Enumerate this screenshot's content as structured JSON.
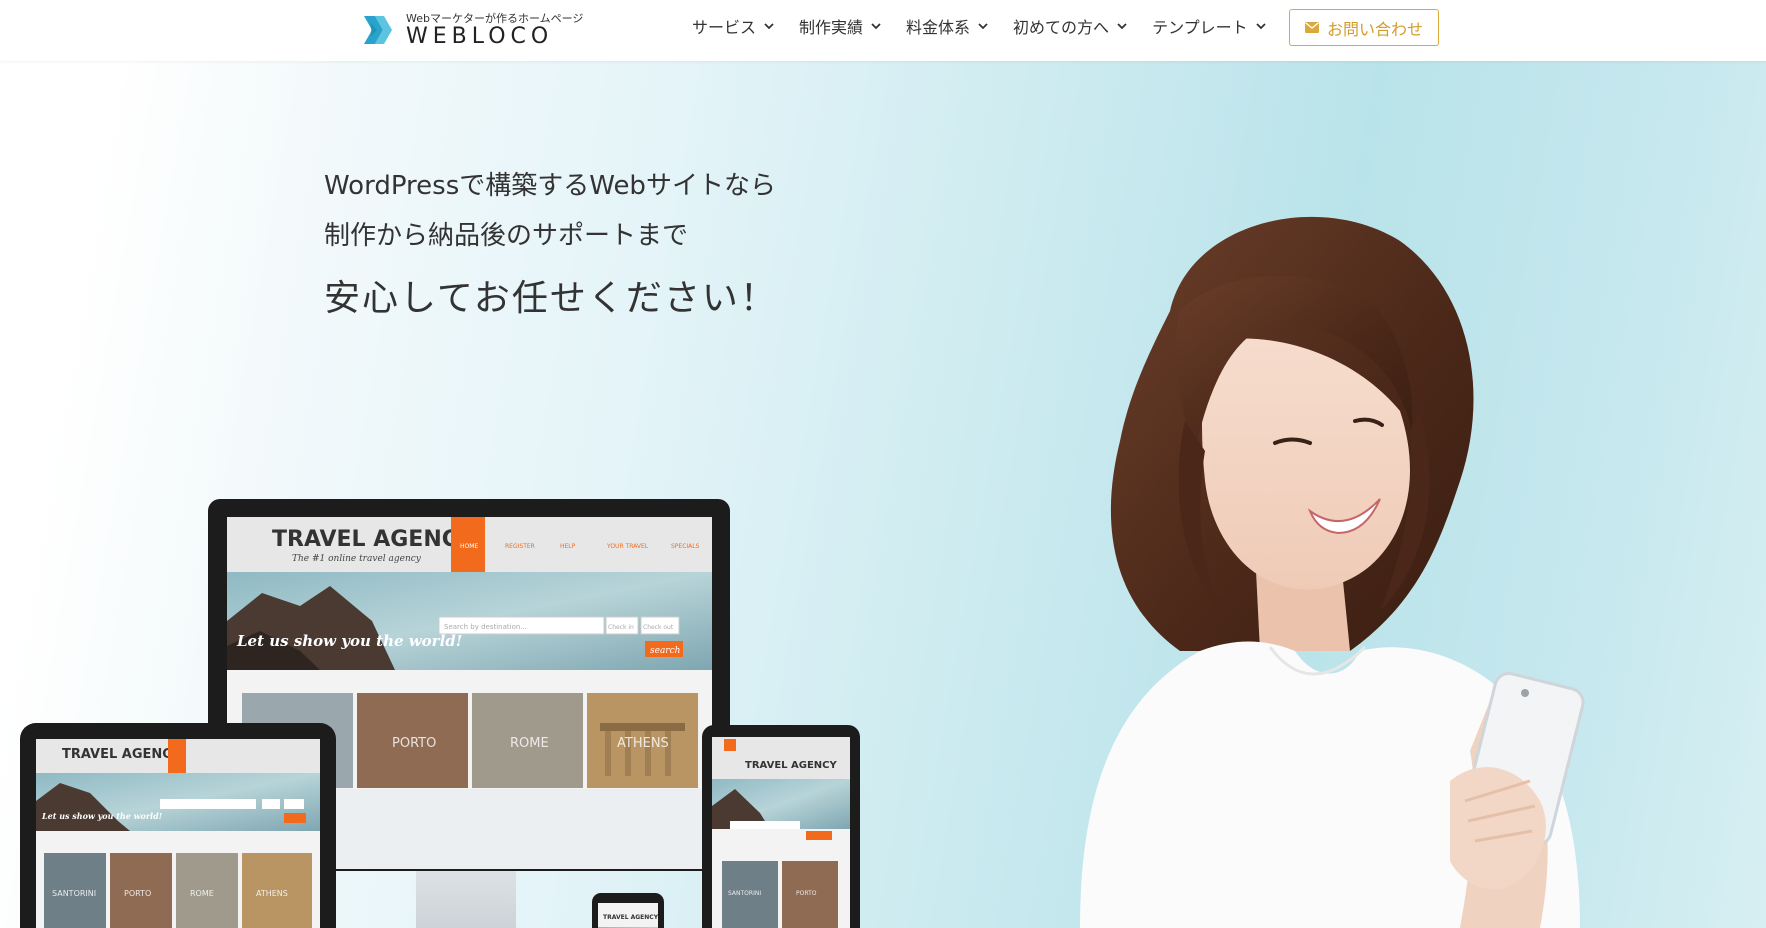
{
  "header": {
    "logo": {
      "tagline": "Webマーケターが作るホームページ",
      "name": "WEBLOCO",
      "icon": "chevron-double-logo-icon",
      "color": "#2da6cf"
    },
    "nav": [
      {
        "label": "サービス"
      },
      {
        "label": "制作実績"
      },
      {
        "label": "料金体系"
      },
      {
        "label": "初めての方へ"
      },
      {
        "label": "テンプレート"
      }
    ],
    "contact_button": {
      "label": "お問い合わせ",
      "icon": "envelope-icon",
      "color": "#d9a93a"
    }
  },
  "hero": {
    "line1": "WordPressで構築するWebサイトなら",
    "line2": "制作から納品後のサポートまで",
    "line3": "安心してお任せください！",
    "devices_image": {
      "brand": "TRAVEL AGENCY",
      "tagline": "The #1 online travel agency",
      "headline": "Let us show you the world!",
      "menu": [
        "HOME",
        "REGISTER",
        "HELP",
        "YOUR TRAVEL",
        "SPECIALS"
      ],
      "search_placeholder": "Search by destination...",
      "check_in": "Check in",
      "check_out": "Check out",
      "search_button": "search",
      "cities": [
        "PORTO",
        "ROME",
        "ATHENS"
      ],
      "cities_small": [
        "SANTORINI",
        "PORTO",
        "ROME",
        "ATHENS"
      ],
      "accent": "#f26b1d"
    },
    "person_image": "woman-with-smartphone"
  }
}
